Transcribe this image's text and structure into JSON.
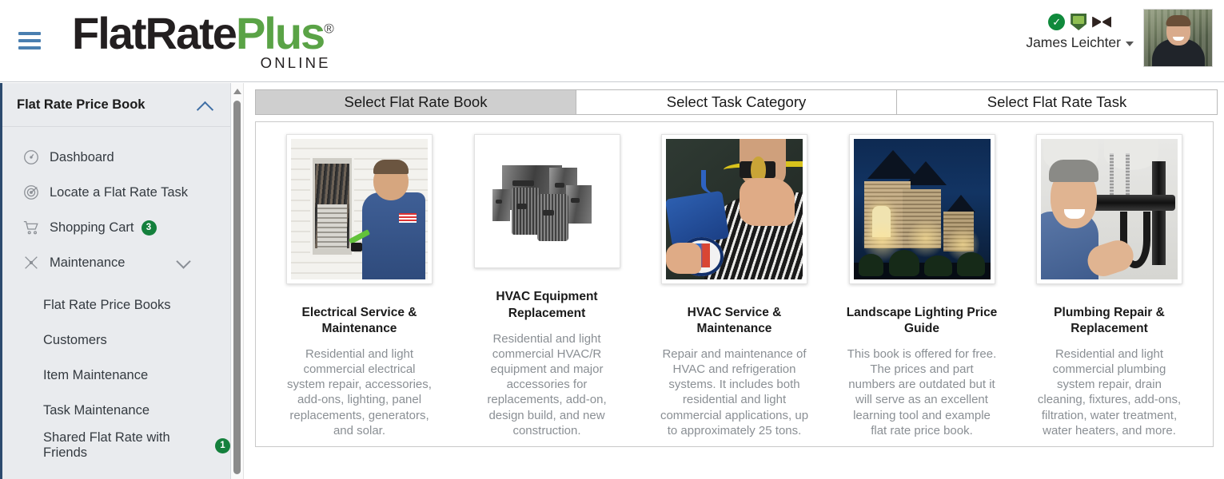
{
  "header": {
    "menu_icon": "hamburger-icon",
    "logo": {
      "part1": "FlatRate",
      "part2": "Plus",
      "trademark": "®",
      "subtitle": "ONLINE"
    },
    "user": {
      "name": "James Leichter",
      "badges": [
        "verified-check-badge",
        "shield-award-badge",
        "bowtie-badge"
      ]
    }
  },
  "sidebar": {
    "panel_title": "Flat Rate Price Book",
    "collapse_icon": "chevron-up-icon",
    "items": [
      {
        "label": "Dashboard",
        "icon": "gauge-icon",
        "badge": null,
        "expand": null
      },
      {
        "label": "Locate a Flat Rate Task",
        "icon": "radar-target-icon",
        "badge": null,
        "expand": null
      },
      {
        "label": "Shopping Cart",
        "icon": "shopping-cart-icon",
        "badge": "3",
        "expand": null
      },
      {
        "label": "Maintenance",
        "icon": "tools-icon",
        "badge": null,
        "expand": "chevron-down-icon"
      }
    ],
    "sub_items": [
      {
        "label": "Flat Rate Price Books",
        "badge": null
      },
      {
        "label": "Customers",
        "badge": null
      },
      {
        "label": "Item Maintenance",
        "badge": null
      },
      {
        "label": "Task Maintenance",
        "badge": null
      },
      {
        "label": "Shared Flat Rate with Friends",
        "badge": "1"
      }
    ],
    "scrollbar": {
      "up_arrow": "scroll-up-arrow"
    }
  },
  "main": {
    "tabs": [
      {
        "label": "Select Flat Rate Book",
        "active": true
      },
      {
        "label": "Select Task Category",
        "active": false
      },
      {
        "label": "Select Flat Rate Task",
        "active": false
      }
    ],
    "books": [
      {
        "title": "Electrical Service & Maintenance",
        "description": "Residential and light commercial electrical system repair, accessories, add-ons, lighting, panel replacements, generators, and solar.",
        "image": "electrician-at-breaker-panel-photo"
      },
      {
        "title": "HVAC Equipment Replacement",
        "description": "Residential and light commercial HVAC/R equipment and major accessories for replacements, add-on, design build, and new construction.",
        "image": "hvac-condenser-units-photo"
      },
      {
        "title": "HVAC Service & Maintenance",
        "description": "Repair and maintenance of HVAC and refrigeration systems. It includes both residential and light commercial applications, up to approximately 25 tons.",
        "image": "hvac-technician-gauges-photo"
      },
      {
        "title": "Landscape Lighting Price Guide",
        "description": "This book is offered for free. The prices and part numbers are outdated but it will serve as an excellent learning tool and example flat rate price book.",
        "image": "lit-stone-house-at-night-photo"
      },
      {
        "title": "Plumbing Repair & Replacement",
        "description": "Residential and light commercial plumbing system repair, drain cleaning, fixtures, add-ons, filtration, water treatment, water heaters, and more.",
        "image": "plumber-under-sink-photo"
      }
    ]
  },
  "colors": {
    "brand_green": "#5aa346",
    "brand_dark": "#231f20",
    "accent_blue": "#4a7fb0",
    "sidebar_bg": "#e9ebee",
    "badge_green": "#14803c",
    "tab_active_bg": "#cfcfcf"
  }
}
